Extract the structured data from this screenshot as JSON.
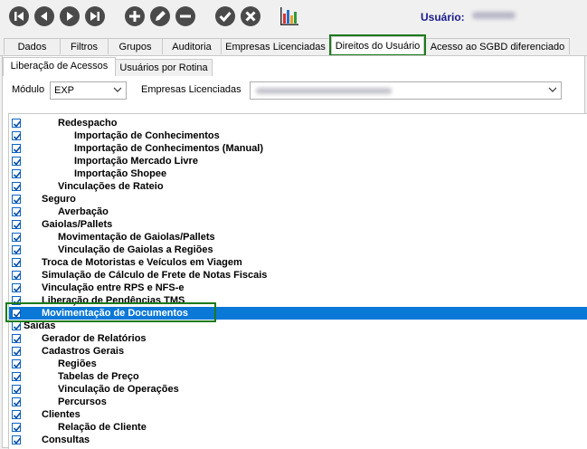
{
  "toolbar": {
    "buttons": [
      {
        "name": "first-record-button",
        "icon": "skip-first-icon"
      },
      {
        "name": "previous-record-button",
        "icon": "previous-icon"
      },
      {
        "name": "next-record-button",
        "icon": "next-icon"
      },
      {
        "name": "last-record-button",
        "icon": "skip-last-icon"
      },
      {
        "name": "add-button",
        "icon": "plus-icon"
      },
      {
        "name": "edit-button",
        "icon": "pencil-icon"
      },
      {
        "name": "remove-button",
        "icon": "minus-icon"
      },
      {
        "name": "confirm-button",
        "icon": "check-icon"
      },
      {
        "name": "cancel-button",
        "icon": "close-icon"
      },
      {
        "name": "report-button",
        "icon": "bar-chart-icon"
      }
    ],
    "user_label": "Usuário:"
  },
  "tabs": [
    "Dados",
    "Filtros",
    "Grupos",
    "Auditoria",
    "Empresas Licenciadas",
    "Direitos do Usuário",
    "Acesso ao SGBD diferenciado"
  ],
  "active_tab": "Direitos do Usuário",
  "subtabs": [
    "Liberação de Acessos",
    "Usuários por Rotina"
  ],
  "filters": {
    "modulo_label": "Módulo",
    "modulo_value": "EXP",
    "empresas_label": "Empresas Licenciadas"
  },
  "tree": [
    {
      "text": "Redespacho",
      "level": 2,
      "checked": true
    },
    {
      "text": "Importação de Conhecimentos",
      "level": 3,
      "checked": true
    },
    {
      "text": "Importação de Conhecimentos (Manual)",
      "level": 3,
      "checked": true
    },
    {
      "text": "Importação Mercado Livre",
      "level": 3,
      "checked": true
    },
    {
      "text": "Importação Shopee",
      "level": 3,
      "checked": true
    },
    {
      "text": "Vinculações de Rateio",
      "level": 2,
      "checked": true
    },
    {
      "text": "Seguro",
      "level": 1,
      "checked": true
    },
    {
      "text": "Averbação",
      "level": 2,
      "checked": true
    },
    {
      "text": "Gaiolas/Pallets",
      "level": 1,
      "checked": true
    },
    {
      "text": "Movimentação de Gaiolas/Pallets",
      "level": 2,
      "checked": true
    },
    {
      "text": "Vinculação de Gaiolas a Regiões",
      "level": 2,
      "checked": true
    },
    {
      "text": "Troca de Motoristas e Veículos em Viagem",
      "level": 1,
      "checked": true
    },
    {
      "text": "Simulação de Cálculo de Frete de Notas Fiscais",
      "level": 1,
      "checked": true
    },
    {
      "text": "Vinculação entre RPS e NFS-e",
      "level": 1,
      "checked": true
    },
    {
      "text": "Liberação de Pendências TMS",
      "level": 1,
      "checked": true
    },
    {
      "text": "Movimentação de Documentos",
      "level": 1,
      "checked": true,
      "selected": true
    },
    {
      "text": "Saídas",
      "level": 0,
      "checked": true
    },
    {
      "text": "Gerador de Relatórios",
      "level": 1,
      "checked": true
    },
    {
      "text": "Cadastros Gerais",
      "level": 1,
      "checked": true
    },
    {
      "text": "Regiões",
      "level": 2,
      "checked": true
    },
    {
      "text": "Tabelas de Preço",
      "level": 2,
      "checked": true
    },
    {
      "text": "Vinculação de Operações",
      "level": 2,
      "checked": true
    },
    {
      "text": "Percursos",
      "level": 2,
      "checked": true
    },
    {
      "text": "Clientes",
      "level": 1,
      "checked": true
    },
    {
      "text": "Relação de Cliente",
      "level": 2,
      "checked": true
    },
    {
      "text": "Consultas",
      "level": 1,
      "checked": true
    }
  ],
  "colors": {
    "selection": "#0a78d7",
    "highlight_box": "#1c7a1c",
    "user_label": "#1a1a8c"
  }
}
